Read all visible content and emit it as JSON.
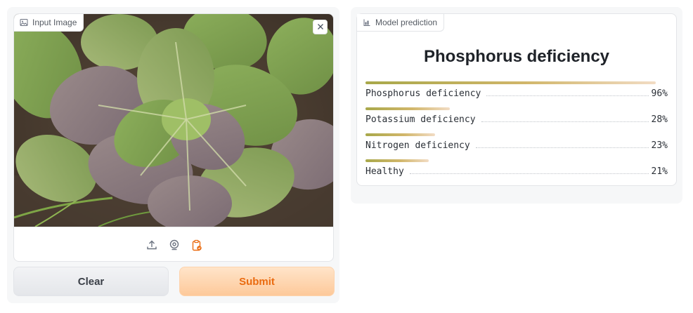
{
  "input": {
    "tag_label": "Input Image",
    "tag_icon": "image-icon",
    "close_icon": "close-icon",
    "tools": [
      "upload-icon",
      "webcam-icon",
      "clipboard-icon"
    ],
    "accent_color": "#ea6b10"
  },
  "buttons": {
    "clear_label": "Clear",
    "submit_label": "Submit"
  },
  "prediction": {
    "tag_label": "Model prediction",
    "tag_icon": "label-icon",
    "top_label": "Phosphorus deficiency",
    "items": [
      {
        "label": "Phosphorus deficiency",
        "percent": "96%",
        "confidence": 0.96
      },
      {
        "label": "Potassium deficiency",
        "percent": "28%",
        "confidence": 0.28
      },
      {
        "label": "Nitrogen deficiency",
        "percent": "23%",
        "confidence": 0.23
      },
      {
        "label": "Healthy",
        "percent": "21%",
        "confidence": 0.21
      }
    ]
  }
}
